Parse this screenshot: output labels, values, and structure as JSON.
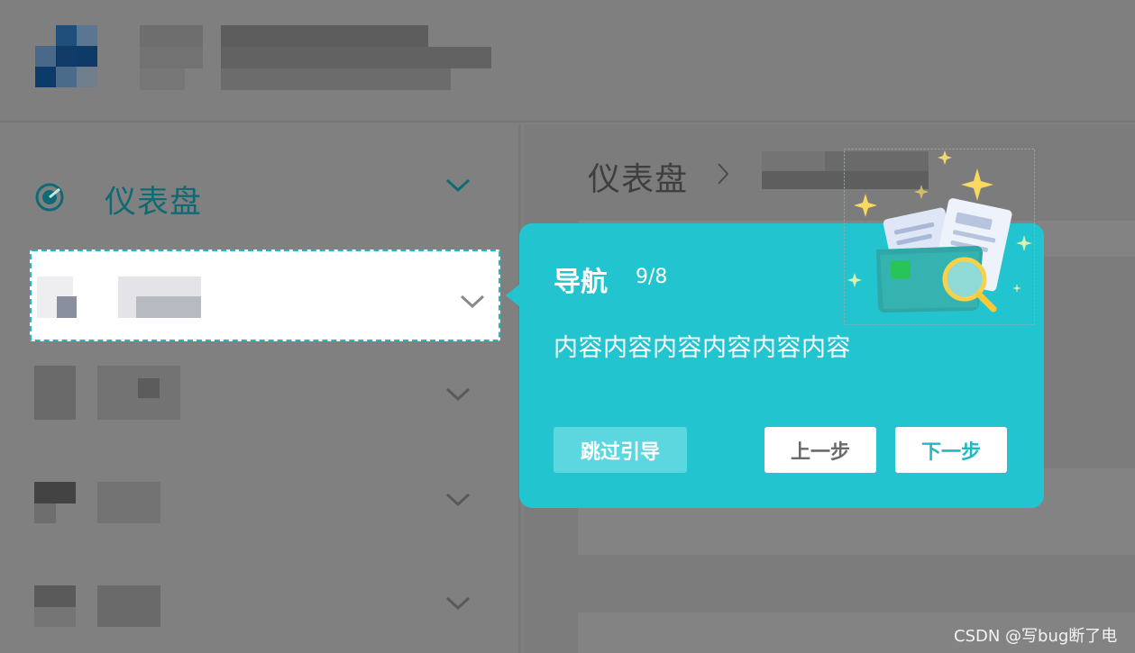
{
  "breadcrumb": {
    "home": "仪表盘"
  },
  "sidebar": {
    "items": [
      {
        "label": "仪表盘",
        "icon": "dashboard-icon"
      }
    ]
  },
  "guide": {
    "title": "导航",
    "step": "9/8",
    "content": "内容内容内容内容内容内容",
    "skip_label": "跳过引导",
    "prev_label": "上一步",
    "next_label": "下一步",
    "illustration_icon": "folder-search-icon",
    "accent_color": "#21c4cf"
  },
  "watermark": "CSDN @写bug断了电"
}
